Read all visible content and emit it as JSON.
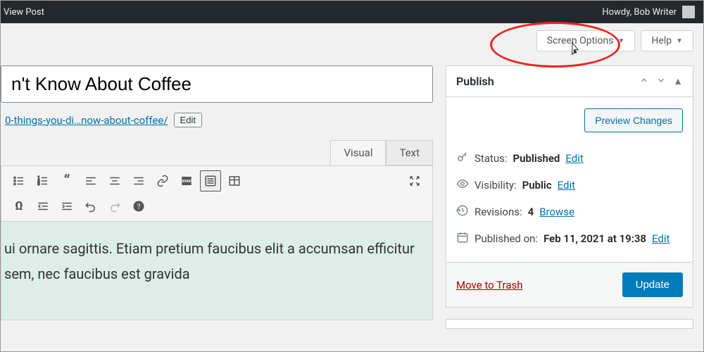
{
  "adminbar": {
    "view_post": "View Post",
    "greeting": "Howdy, Bob Writer"
  },
  "panel_tabs": {
    "screen_options": "Screen Options",
    "help": "Help"
  },
  "title": "n't Know About Coffee",
  "permalink": {
    "slug": "0-things-you-di…now-about-coffee/",
    "edit": "Edit"
  },
  "editor_tabs": {
    "visual": "Visual",
    "text": "Text"
  },
  "content_excerpt": "ui ornare sagittis. Etiam pretium faucibus elit a accumsan efficitur sem, nec faucibus est gravida",
  "publish": {
    "heading": "Publish",
    "preview": "Preview Changes",
    "status_label": "Status:",
    "status_value": "Published",
    "visibility_label": "Visibility:",
    "visibility_value": "Public",
    "revisions_label": "Revisions:",
    "revisions_value": "4",
    "browse": "Browse",
    "published_label": "Published on:",
    "published_value": "Feb 11, 2021 at 19:38",
    "edit": "Edit",
    "trash": "Move to Trash",
    "update": "Update"
  }
}
